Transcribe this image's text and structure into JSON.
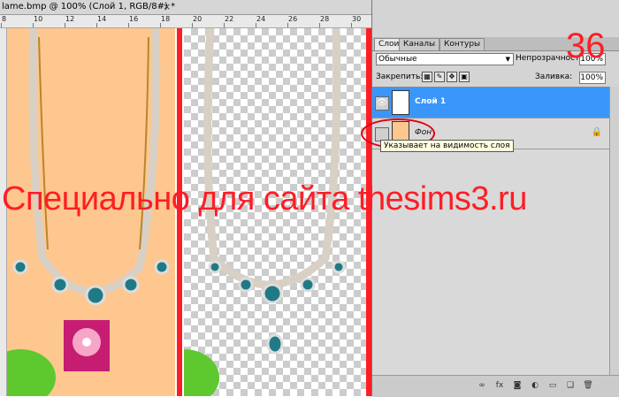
{
  "window": {
    "title": "lame.bmp @ 100% (Слой 1, RGB/8#) *",
    "close_glyph": "×"
  },
  "ruler": {
    "labels": [
      "8",
      "10",
      "12",
      "14",
      "16",
      "18",
      "20",
      "22",
      "24",
      "26",
      "28",
      "30"
    ]
  },
  "panel": {
    "tabs": [
      "Слои",
      "Каналы",
      "Контуры"
    ],
    "blend_mode": "Обычные",
    "opacity_label": "Непрозрачность:",
    "opacity_value": "100%",
    "lock_label": "Закрепить:",
    "fill_label": "Заливка:",
    "fill_value": "100%",
    "layers": [
      {
        "name": "Слой 1",
        "selected": true
      },
      {
        "name": "Фон",
        "selected": false
      }
    ]
  },
  "tooltip": "Указывает на видимость слоя",
  "watermark": "Специально для сайта thesims3.ru",
  "step_number": "36",
  "colors": {
    "accent_red": "#ff1d25",
    "selected_layer": "#3a96fa",
    "canvas_bg": "#fec78f"
  }
}
